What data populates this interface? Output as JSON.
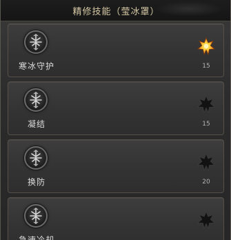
{
  "header": {
    "title": "精修技能（莹冰罩）"
  },
  "skills": [
    {
      "name": "寒冰守护",
      "level": "15",
      "active": true
    },
    {
      "name": "凝结",
      "level": "15",
      "active": false
    },
    {
      "name": "换防",
      "level": "20",
      "active": false
    },
    {
      "name": "急速冷却",
      "level": "",
      "active": false
    }
  ],
  "icons": {
    "skill_icon": "ice-rune-icon",
    "active_star": "gold-star-icon",
    "inactive_star": "dark-star-icon"
  },
  "colors": {
    "star_active_outer": "#ffcf3a",
    "star_active_inner": "#ff8a1a",
    "star_inactive": "#101010",
    "title": "#d7c9a6"
  }
}
